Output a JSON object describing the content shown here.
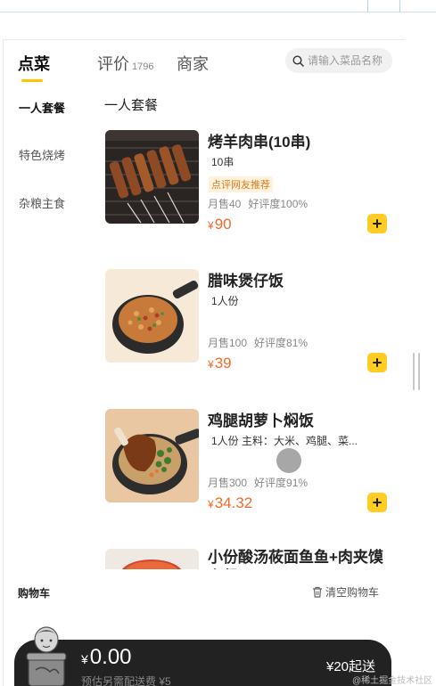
{
  "tabs": [
    {
      "label": "点菜",
      "count": ""
    },
    {
      "label": "评价",
      "count": "1796"
    },
    {
      "label": "商家",
      "count": ""
    }
  ],
  "search": {
    "placeholder": "请输入菜品名称"
  },
  "sidebar": {
    "items": [
      {
        "label": "一人套餐",
        "active": true
      },
      {
        "label": "特色烧烤",
        "active": false
      },
      {
        "label": "杂粮主食",
        "active": false
      }
    ]
  },
  "section": {
    "title": "一人套餐"
  },
  "dishes": [
    {
      "name": "烤羊肉串(10串)",
      "desc": "10串",
      "tag": "点评网友推荐",
      "sales": "月售40",
      "rating": "好评度100%",
      "currency": "¥",
      "price": "90",
      "image": "lamb-skewers"
    },
    {
      "name": "腊味煲仔饭",
      "desc": "1人份",
      "tag": "",
      "sales": "月售100",
      "rating": "好评度81%",
      "currency": "¥",
      "price": "39",
      "image": "claypot-rice"
    },
    {
      "name": "鸡腿胡萝卜焖饭",
      "desc": "1人份 主料：大米、鸡腿、菜...",
      "tag": "",
      "sales": "月售300",
      "rating": "好评度91%",
      "currency": "¥",
      "price": "34.32",
      "image": "chicken-leg-rice"
    },
    {
      "name": "小份酸汤莜面鱼鱼+肉夹馍套餐",
      "desc": "",
      "tag": "",
      "sales": "",
      "rating": "",
      "currency": "",
      "price": "",
      "image": "sour-soup"
    }
  ],
  "cart": {
    "title": "购物车",
    "clear_label": "清空购物车",
    "currency": "¥",
    "total": "0.00",
    "delivery_note": "预估另需配送费 ¥5",
    "min_order": "¥20起送"
  },
  "watermark": "@稀土掘金技术社区",
  "colors": {
    "accent": "#ffcc23",
    "price": "#f5692b",
    "checkout_bg": "#222222",
    "tag_text": "#d97a1c"
  }
}
